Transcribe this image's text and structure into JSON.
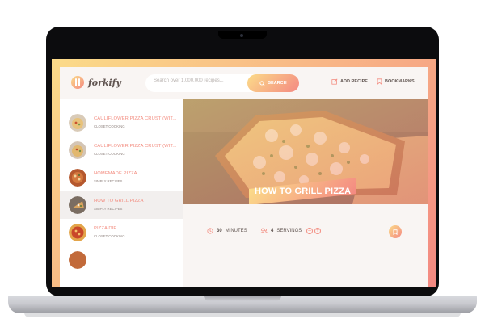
{
  "app": {
    "logo_text": "forkify"
  },
  "search": {
    "placeholder": "Search over 1,000,000 recipes...",
    "button_label": "SEARCH",
    "icon": "search-icon"
  },
  "nav": {
    "add_recipe": "ADD RECIPE",
    "bookmarks": "BOOKMARKS"
  },
  "results": [
    {
      "title": "CAULIFLOWER PIZZA CRUST (WIT...",
      "publisher": "CLOSET COOKING",
      "active": false
    },
    {
      "title": "CAULIFLOWER PIZZA CRUST (WIT...",
      "publisher": "CLOSET COOKING",
      "active": false
    },
    {
      "title": "HOMEMADE PIZZA",
      "publisher": "SIMPLY RECIPES",
      "active": false
    },
    {
      "title": "HOW TO GRILL PIZZA",
      "publisher": "SIMPLY RECIPES",
      "active": true
    },
    {
      "title": "PIZZA DIP",
      "publisher": "CLOSET COOKING",
      "active": false
    }
  ],
  "recipe": {
    "title": "HOW TO GRILL PIZZA",
    "minutes_value": "30",
    "minutes_label": "MINUTES",
    "servings_value": "4",
    "servings_label": "SERVINGS"
  },
  "colors": {
    "accent_light": "#fbdb89",
    "accent_dark": "#f48982",
    "text_dark": "#615551",
    "link": "#f38e82"
  }
}
